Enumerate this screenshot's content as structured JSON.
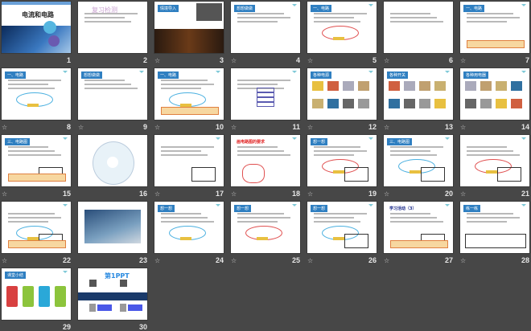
{
  "view": "slide-sorter",
  "slides": [
    {
      "number": "1",
      "starred": false,
      "title": "电流和电路"
    },
    {
      "number": "2",
      "starred": false,
      "title": "复习检测"
    },
    {
      "number": "3",
      "starred": true,
      "title": "情境导入"
    },
    {
      "number": "4",
      "starred": true,
      "title": "想想做做"
    },
    {
      "number": "5",
      "starred": true,
      "title": "一、电路"
    },
    {
      "number": "6",
      "starred": true,
      "title": ""
    },
    {
      "number": "7",
      "starred": true,
      "title": "一、电路"
    },
    {
      "number": "8",
      "starred": true,
      "title": "一、电路"
    },
    {
      "number": "9",
      "starred": true,
      "title": "想想做做"
    },
    {
      "number": "10",
      "starred": true,
      "title": "一、电路"
    },
    {
      "number": "11",
      "starred": true,
      "title": ""
    },
    {
      "number": "12",
      "starred": true,
      "title": "各种电源"
    },
    {
      "number": "13",
      "starred": true,
      "title": "各种开关"
    },
    {
      "number": "14",
      "starred": true,
      "title": "各种用电器"
    },
    {
      "number": "15",
      "starred": true,
      "title": "三、电路图"
    },
    {
      "number": "16",
      "starred": false,
      "title": ""
    },
    {
      "number": "17",
      "starred": true,
      "title": ""
    },
    {
      "number": "18",
      "starred": true,
      "title": "画电路图的要求"
    },
    {
      "number": "19",
      "starred": true,
      "title": "想一想"
    },
    {
      "number": "20",
      "starred": true,
      "title": "三、电路图"
    },
    {
      "number": "21",
      "starred": true,
      "title": ""
    },
    {
      "number": "22",
      "starred": true,
      "title": ""
    },
    {
      "number": "23",
      "starred": false,
      "title": ""
    },
    {
      "number": "24",
      "starred": true,
      "title": "想一想"
    },
    {
      "number": "25",
      "starred": true,
      "title": "想一想"
    },
    {
      "number": "26",
      "starred": true,
      "title": "想一想"
    },
    {
      "number": "27",
      "starred": true,
      "title": "学习活动（3）"
    },
    {
      "number": "28",
      "starred": true,
      "title": "练一练"
    },
    {
      "number": "29",
      "starred": false,
      "title": "课堂小结"
    },
    {
      "number": "30",
      "starred": false,
      "title": "第1PPT"
    }
  ],
  "colors": {
    "background": "#474747",
    "accent": "#2f7fc1"
  }
}
